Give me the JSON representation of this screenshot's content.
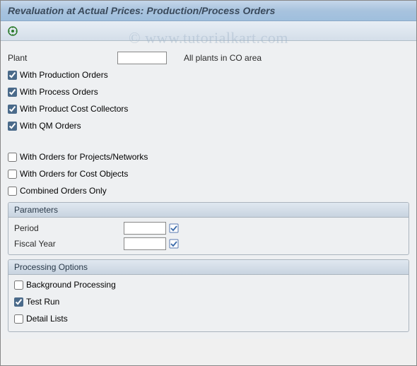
{
  "title": "Revaluation at Actual Prices: Production/Process Orders",
  "watermark": "© www.tutorialkart.com",
  "plant": {
    "label": "Plant",
    "value": "",
    "note": "All plants in CO area"
  },
  "orderTypes": [
    {
      "label": "With Production Orders",
      "checked": true
    },
    {
      "label": "With Process Orders",
      "checked": true
    },
    {
      "label": "With Product Cost Collectors",
      "checked": true
    },
    {
      "label": "With QM Orders",
      "checked": true
    }
  ],
  "orderScope": [
    {
      "label": "With Orders for Projects/Networks",
      "checked": false
    },
    {
      "label": "With Orders for Cost Objects",
      "checked": false
    },
    {
      "label": "Combined Orders Only",
      "checked": false
    }
  ],
  "parameters": {
    "title": "Parameters",
    "fields": [
      {
        "label": "Period",
        "value": "",
        "required": true
      },
      {
        "label": "Fiscal Year",
        "value": "",
        "required": true
      }
    ]
  },
  "processing": {
    "title": "Processing Options",
    "options": [
      {
        "label": "Background Processing",
        "checked": false
      },
      {
        "label": "Test Run",
        "checked": true
      },
      {
        "label": "Detail Lists",
        "checked": false
      }
    ]
  }
}
